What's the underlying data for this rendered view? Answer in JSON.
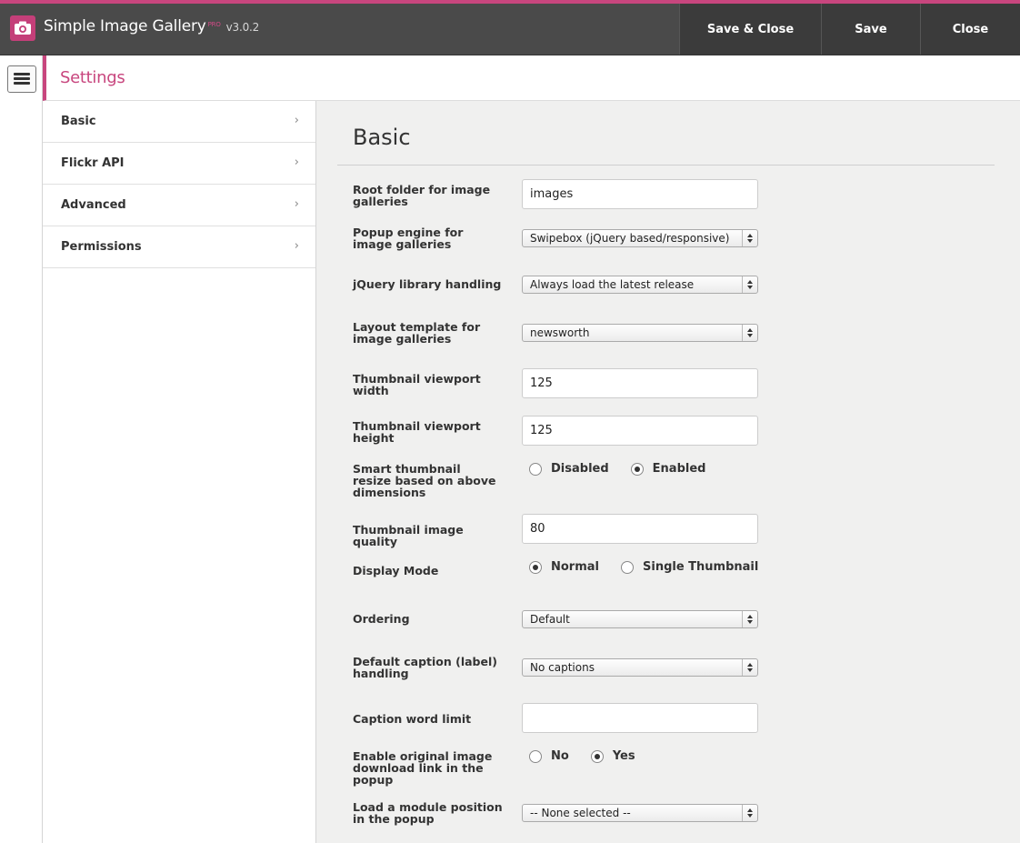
{
  "app": {
    "title": "Simple Image Gallery",
    "pro_badge": "PRO",
    "version": "v3.0.2",
    "logo_icon": "camera-icon",
    "accent_color": "#c8467e"
  },
  "toolbar": {
    "save_close_label": "Save & Close",
    "save_label": "Save",
    "close_label": "Close"
  },
  "page": {
    "title": "Settings"
  },
  "tabs": [
    {
      "label": "Basic"
    },
    {
      "label": "Flickr API"
    },
    {
      "label": "Advanced"
    },
    {
      "label": "Permissions"
    }
  ],
  "section": {
    "title": "Basic"
  },
  "fields": {
    "root_folder": {
      "label": "Root folder for image galleries",
      "value": "images"
    },
    "popup_engine": {
      "label": "Popup engine for image galleries",
      "value": "Swipebox (jQuery based/responsive)"
    },
    "jquery": {
      "label": "jQuery library handling",
      "value": "Always load the latest release"
    },
    "layout": {
      "label": "Layout template for image galleries",
      "value": "newsworth"
    },
    "thumb_width": {
      "label": "Thumbnail viewport width",
      "value": "125"
    },
    "thumb_height": {
      "label": "Thumbnail viewport height",
      "value": "125"
    },
    "smart_resize": {
      "label": "Smart thumbnail resize based on above dimensions",
      "options": [
        "Disabled",
        "Enabled"
      ],
      "selected": "Enabled"
    },
    "thumb_quality": {
      "label": "Thumbnail image quality",
      "value": "80"
    },
    "display_mode": {
      "label": "Display Mode",
      "options": [
        "Normal",
        "Single Thumbnail"
      ],
      "selected": "Normal"
    },
    "ordering": {
      "label": "Ordering",
      "value": "Default"
    },
    "caption": {
      "label": "Default caption (label) handling",
      "value": "No captions"
    },
    "caption_limit": {
      "label": "Caption word limit",
      "value": ""
    },
    "download_link": {
      "label": "Enable original image download link in the popup",
      "options": [
        "No",
        "Yes"
      ],
      "selected": "Yes"
    },
    "module_position": {
      "label": "Load a module position in the popup",
      "value": "-- None selected --"
    }
  }
}
